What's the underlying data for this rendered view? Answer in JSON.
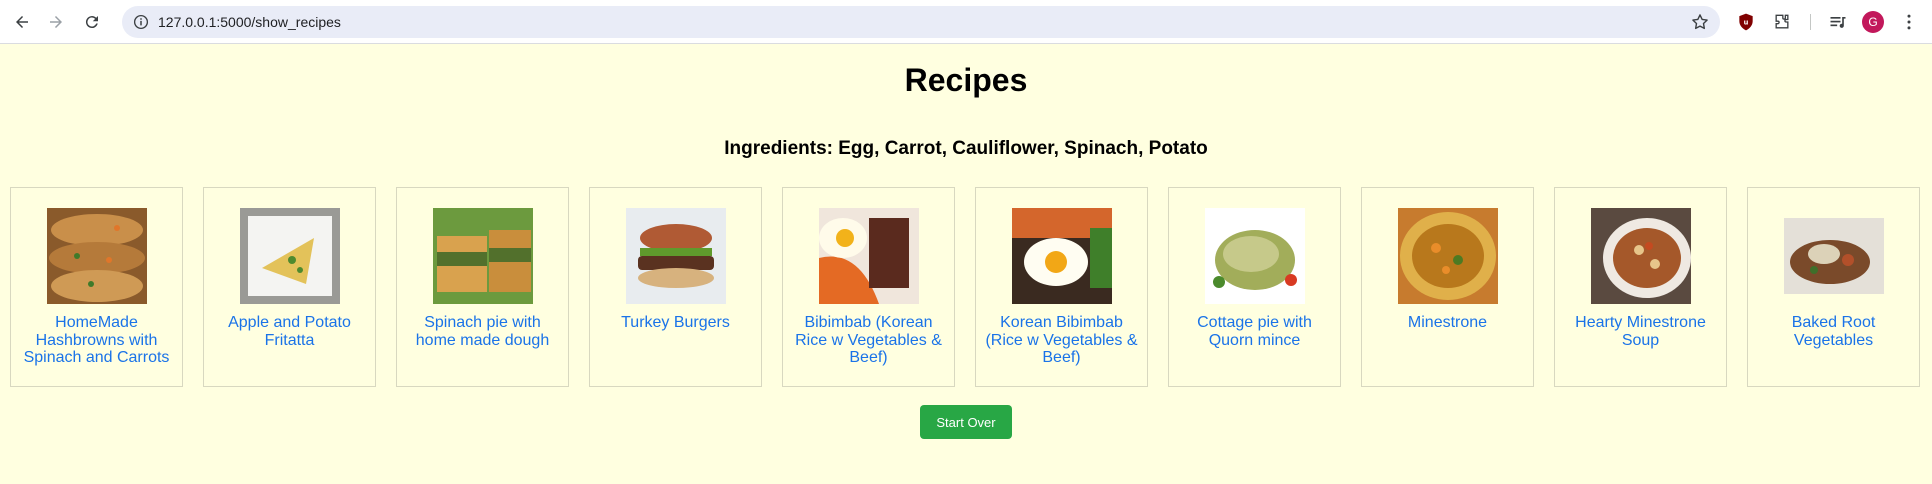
{
  "browser": {
    "url": "127.0.0.1:5000/show_recipes",
    "avatar_letter": "G",
    "accent": "#1a73e8"
  },
  "page": {
    "title": "Recipes",
    "ingredients_line": "Ingredients: Egg, Carrot, Cauliflower, Spinach, Potato",
    "background": "#ffffe0",
    "start_over_label": "Start Over",
    "start_over_color": "#28a745"
  },
  "recipes": [
    {
      "title": "HomeMade Hashbrowns with Spinach and Carrots",
      "thumb": "hashbrowns-photo"
    },
    {
      "title": "Apple and Potato Fritatta",
      "thumb": "fritatta-photo"
    },
    {
      "title": "Spinach pie with home made dough",
      "thumb": "spinach-pie-photo"
    },
    {
      "title": "Turkey Burgers",
      "thumb": "burger-photo"
    },
    {
      "title": "Bibimbab (Korean Rice w Vegetables & Beef)",
      "thumb": "bibimbab-photo"
    },
    {
      "title": "Korean Bibimbab (Rice w Vegetables & Beef)",
      "thumb": "korean-bibimbab-photo"
    },
    {
      "title": "Cottage pie with Quorn mince",
      "thumb": "cottage-pie-photo"
    },
    {
      "title": "Minestrone",
      "thumb": "minestrone-photo"
    },
    {
      "title": "Hearty Minestrone Soup",
      "thumb": "hearty-minestrone-photo"
    },
    {
      "title": "Baked Root Vegetables",
      "thumb": "root-vegetables-photo"
    }
  ]
}
